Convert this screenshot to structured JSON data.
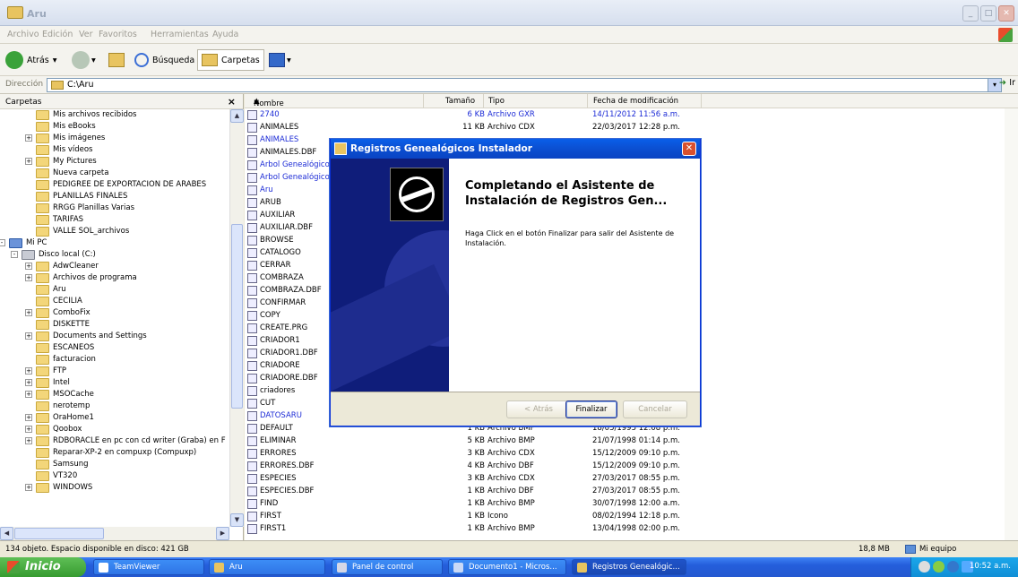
{
  "window": {
    "title": "Aru"
  },
  "menu": [
    "Archivo",
    "Edición",
    "Ver",
    "Favoritos",
    "Herramientas",
    "Ayuda"
  ],
  "toolbar": {
    "back": "Atrás",
    "search": "Búsqueda",
    "folders": "Carpetas"
  },
  "address": {
    "label": "Dirección",
    "value": "C:\\Aru",
    "go": "Ir"
  },
  "leftpane": {
    "title": "Carpetas",
    "items": [
      {
        "label": "Mis archivos recibidos",
        "indent": 3,
        "exp": ""
      },
      {
        "label": "Mis eBooks",
        "indent": 3,
        "exp": ""
      },
      {
        "label": "Mis imágenes",
        "indent": 3,
        "exp": "+"
      },
      {
        "label": "Mis vídeos",
        "indent": 3,
        "exp": ""
      },
      {
        "label": "My Pictures",
        "indent": 3,
        "exp": "+"
      },
      {
        "label": "Nueva carpeta",
        "indent": 3,
        "exp": ""
      },
      {
        "label": "PEDIGREE DE EXPORTACION DE ARABES",
        "indent": 3,
        "exp": ""
      },
      {
        "label": "PLANILLAS FINALES",
        "indent": 3,
        "exp": ""
      },
      {
        "label": "RRGG Planillas Varias",
        "indent": 3,
        "exp": ""
      },
      {
        "label": "TARIFAS",
        "indent": 3,
        "exp": ""
      },
      {
        "label": "VALLE SOL_archivos",
        "indent": 3,
        "exp": ""
      },
      {
        "label": "Mi PC",
        "indent": 1,
        "exp": "-"
      },
      {
        "label": "Disco local (C:)",
        "indent": 2,
        "exp": "-"
      },
      {
        "label": "AdwCleaner",
        "indent": 3,
        "exp": "+"
      },
      {
        "label": "Archivos de programa",
        "indent": 3,
        "exp": "+"
      },
      {
        "label": "Aru",
        "indent": 3,
        "exp": ""
      },
      {
        "label": "CECILIA",
        "indent": 3,
        "exp": ""
      },
      {
        "label": "ComboFix",
        "indent": 3,
        "exp": "+"
      },
      {
        "label": "DISKETTE",
        "indent": 3,
        "exp": ""
      },
      {
        "label": "Documents and Settings",
        "indent": 3,
        "exp": "+"
      },
      {
        "label": "ESCANEOS",
        "indent": 3,
        "exp": ""
      },
      {
        "label": "facturacion",
        "indent": 3,
        "exp": ""
      },
      {
        "label": "FTP",
        "indent": 3,
        "exp": "+"
      },
      {
        "label": "Intel",
        "indent": 3,
        "exp": "+"
      },
      {
        "label": "MSOCache",
        "indent": 3,
        "exp": "+"
      },
      {
        "label": "nerotemp",
        "indent": 3,
        "exp": ""
      },
      {
        "label": "OraHome1",
        "indent": 3,
        "exp": "+"
      },
      {
        "label": "Qoobox",
        "indent": 3,
        "exp": "+"
      },
      {
        "label": "RDBORACLE en pc con cd writer (Graba) en F",
        "indent": 3,
        "exp": "+"
      },
      {
        "label": "Reparar-XP-2 en compuxp (Compuxp)",
        "indent": 3,
        "exp": ""
      },
      {
        "label": "Samsung",
        "indent": 3,
        "exp": ""
      },
      {
        "label": "VT320",
        "indent": 3,
        "exp": ""
      },
      {
        "label": "WINDOWS",
        "indent": 3,
        "exp": "+"
      }
    ]
  },
  "list": {
    "columns": {
      "name": "Nombre",
      "size": "Tamaño",
      "type": "Tipo",
      "date": "Fecha de modificación"
    },
    "rows": [
      {
        "name": "2740",
        "size": "6 KB",
        "type": "Archivo GXR",
        "date": "14/11/2012 11:56 a.m.",
        "blue": true
      },
      {
        "name": "ANIMALES",
        "size": "11 KB",
        "type": "Archivo CDX",
        "date": "22/03/2017 12:28 p.m.",
        "blue": false
      },
      {
        "name": "ANIMALES",
        "size": "",
        "type": "",
        "date": "",
        "blue": true
      },
      {
        "name": "ANIMALES.DBF",
        "size": "",
        "type": "",
        "date": "",
        "blue": false
      },
      {
        "name": "Arbol Genealógico",
        "size": "",
        "type": "",
        "date": "",
        "blue": true
      },
      {
        "name": "Arbol Genealógico",
        "size": "",
        "type": "",
        "date": "",
        "blue": true
      },
      {
        "name": "Aru",
        "size": "",
        "type": "",
        "date": "",
        "blue": true
      },
      {
        "name": "ARUB",
        "size": "",
        "type": "",
        "date": "",
        "blue": false
      },
      {
        "name": "AUXILIAR",
        "size": "",
        "type": "",
        "date": "",
        "blue": false
      },
      {
        "name": "AUXILIAR.DBF",
        "size": "",
        "type": "",
        "date": "",
        "blue": false
      },
      {
        "name": "BROWSE",
        "size": "",
        "type": "",
        "date": "",
        "blue": false
      },
      {
        "name": "CATALOGO",
        "size": "",
        "type": "",
        "date": "",
        "blue": false
      },
      {
        "name": "CERRAR",
        "size": "",
        "type": "",
        "date": "",
        "blue": false
      },
      {
        "name": "COMBRAZA",
        "size": "",
        "type": "",
        "date": "",
        "blue": false
      },
      {
        "name": "COMBRAZA.DBF",
        "size": "",
        "type": "",
        "date": "",
        "blue": false
      },
      {
        "name": "CONFIRMAR",
        "size": "",
        "type": "",
        "date": "",
        "blue": false
      },
      {
        "name": "COPY",
        "size": "",
        "type": "",
        "date": "",
        "blue": false
      },
      {
        "name": "CREATE.PRG",
        "size": "",
        "type": "",
        "date": "",
        "blue": false
      },
      {
        "name": "CRIADOR1",
        "size": "",
        "type": "",
        "date": "",
        "blue": false
      },
      {
        "name": "CRIADOR1.DBF",
        "size": "",
        "type": "",
        "date": "",
        "blue": false
      },
      {
        "name": "CRIADORE",
        "size": "",
        "type": "",
        "date": "",
        "blue": false
      },
      {
        "name": "CRIADORE.DBF",
        "size": "",
        "type": "",
        "date": "",
        "blue": false
      },
      {
        "name": "criadores",
        "size": "",
        "type": "",
        "date": "",
        "blue": false
      },
      {
        "name": "CUT",
        "size": "",
        "type": "",
        "date": "",
        "blue": false
      },
      {
        "name": "DATOSARU",
        "size": "",
        "type": "",
        "date": "",
        "blue": true
      },
      {
        "name": "DEFAULT",
        "size": "1 KB",
        "type": "Archivo BMP",
        "date": "18/05/1995 12:08 p.m.",
        "blue": false
      },
      {
        "name": "ELIMINAR",
        "size": "5 KB",
        "type": "Archivo BMP",
        "date": "21/07/1998 01:14 p.m.",
        "blue": false
      },
      {
        "name": "ERRORES",
        "size": "3 KB",
        "type": "Archivo CDX",
        "date": "15/12/2009 09:10 p.m.",
        "blue": false
      },
      {
        "name": "ERRORES.DBF",
        "size": "4 KB",
        "type": "Archivo DBF",
        "date": "15/12/2009 09:10 p.m.",
        "blue": false
      },
      {
        "name": "ESPECIES",
        "size": "3 KB",
        "type": "Archivo CDX",
        "date": "27/03/2017 08:55 p.m.",
        "blue": false
      },
      {
        "name": "ESPECIES.DBF",
        "size": "1 KB",
        "type": "Archivo DBF",
        "date": "27/03/2017 08:55 p.m.",
        "blue": false
      },
      {
        "name": "FIND",
        "size": "1 KB",
        "type": "Archivo BMP",
        "date": "30/07/1998 12:00 a.m.",
        "blue": false
      },
      {
        "name": "FIRST",
        "size": "1 KB",
        "type": "Icono",
        "date": "08/02/1994 12:18 p.m.",
        "blue": false
      },
      {
        "name": "FIRST1",
        "size": "1 KB",
        "type": "Archivo BMP",
        "date": "13/04/1998 02:00 p.m.",
        "blue": false
      }
    ]
  },
  "dialog": {
    "title": "Registros Genealógicos Instalador",
    "heading": "Completando el Asistente de Instalación de Registros Gen...",
    "body": "Haga Click en el botón Finalizar para salir del Asistente de Instalación.",
    "back": "< Atrás",
    "finish": "Finalizar",
    "cancel": "Cancelar"
  },
  "status": {
    "left": "134 objeto. Espacio disponible en disco: 421 GB",
    "size": "18,8 MB",
    "location": "Mi equipo"
  },
  "taskbar": {
    "start": "Inicio",
    "items": [
      "TeamViewer",
      "Aru",
      "Panel de control",
      "Documento1 - Micros...",
      "Registros Genealógic..."
    ],
    "clock": "10:52 a.m."
  }
}
